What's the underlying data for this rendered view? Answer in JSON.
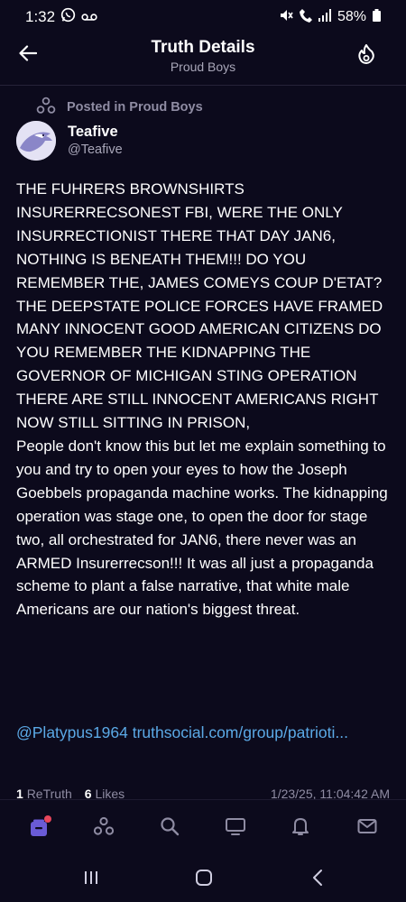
{
  "status_bar": {
    "time": "1:32",
    "battery": "58%",
    "icons": [
      "whatsapp-icon",
      "voicemail-icon",
      "mute-icon",
      "wifi-calling-icon",
      "signal-icon",
      "battery-icon"
    ]
  },
  "header": {
    "title": "Truth Details",
    "subtitle": "Proud Boys",
    "icons": [
      "back-arrow-icon",
      "flame-icon"
    ]
  },
  "post": {
    "posted_in": "Posted in Proud Boys",
    "author_name": "Teafive",
    "author_handle": "@Teafive",
    "body": "THE FUHRERS BROWNSHIRTS INSURERRECSONEST FBI, WERE THE ONLY INSURRECTIONIST THERE THAT DAY JAN6, NOTHING IS BENEATH THEM!!! DO YOU REMEMBER THE, JAMES COMEYS COUP D'ETAT? THE DEEPSTATE POLICE FORCES HAVE FRAMED MANY INNOCENT GOOD AMERICAN CITIZENS DO YOU REMEMBER THE KIDNAPPING THE GOVERNOR OF MICHIGAN STING OPERATION THERE ARE STILL INNOCENT AMERICANS RIGHT NOW STILL SITTING IN PRISON,\nPeople don't know this but let me explain something to you and try to open your eyes to how the Joseph Goebbels propaganda machine works. The kidnapping operation was stage one, to open the door for stage two, all orchestrated for JAN6, there never was an ARMED Insurerrecson!!! It was all just a propaganda scheme to plant a false narrative, that white male Americans are our nation's biggest threat.",
    "mention": "@Platypus1964",
    "link": "truthsocial.com/group/patrioti...",
    "retruth_count": "1",
    "retruth_label": "ReTruth",
    "likes_count": "6",
    "likes_label": "Likes",
    "timestamp": "1/23/25, 11:04:42 AM"
  },
  "bottom_nav": {
    "items": [
      "inbox-icon",
      "groups-icon",
      "search-icon",
      "tv-icon",
      "notifications-icon",
      "messages-icon"
    ]
  },
  "colors": {
    "background": "#0c0a1c",
    "accent": "#6a5bd6",
    "link": "#5ba9e6",
    "muted": "#8f8ca3",
    "badge": "#e8465b"
  }
}
